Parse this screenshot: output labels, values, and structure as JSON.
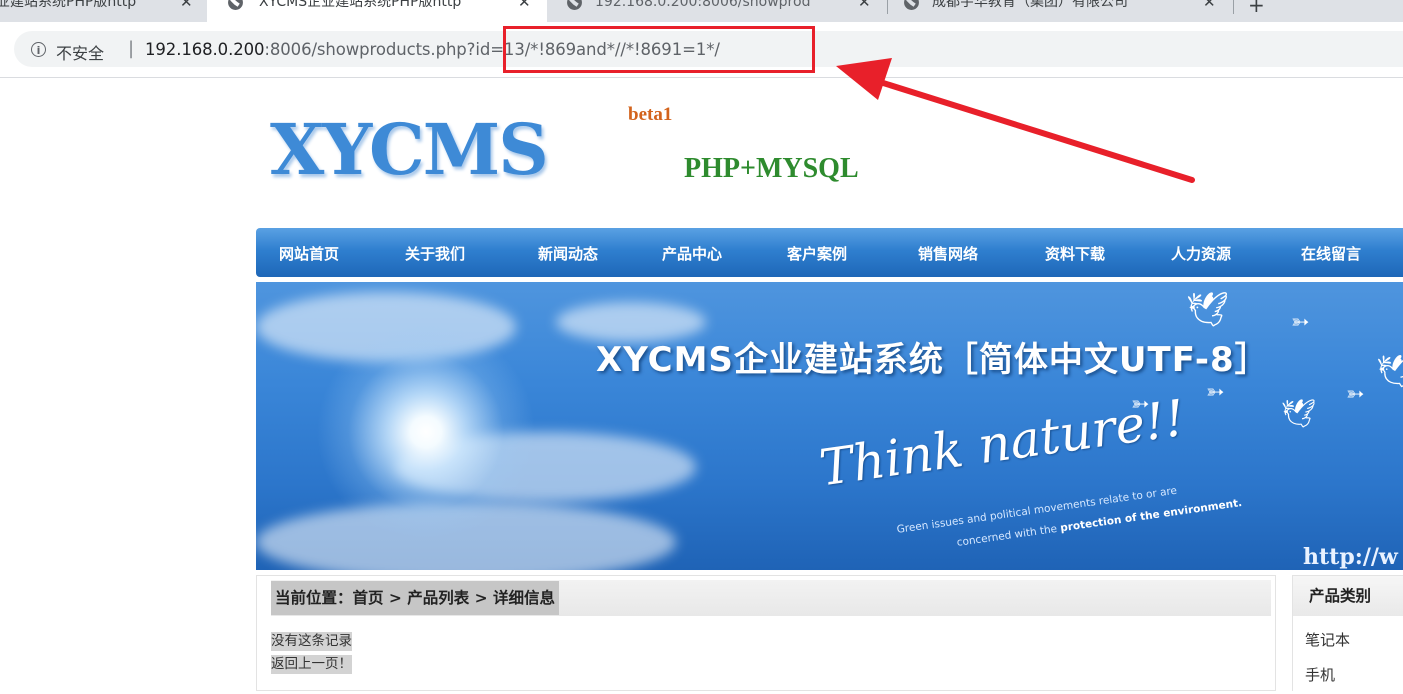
{
  "browser": {
    "tabs": [
      {
        "label": "业建站系统PHP版http"
      },
      {
        "label": "XYCMS企业建站系统PHP版http"
      },
      {
        "label": "192.168.0.200:8006/showprod"
      },
      {
        "label": "成都宇华教育（集团）有限公司"
      }
    ],
    "new_tab_label": "+",
    "close_label": "✕",
    "security_label": "不安全",
    "url_separator": "|",
    "url_host": "192.168.0.200",
    "url_rest": ":8006/showproducts.php?id=13/*!869and*//*!8691=1*/",
    "annotation_color": "#e8202a"
  },
  "site": {
    "logo_text": "XYCMS",
    "beta_label": "beta1",
    "tech_label": "PHP+MYSQL",
    "nav": [
      "网站首页",
      "关于我们",
      "新闻动态",
      "产品中心",
      "客户案例",
      "销售网络",
      "资料下载",
      "人力资源",
      "在线留言"
    ],
    "banner": {
      "title": "XYCMS企业建站系统［简体中文UTF-8］",
      "slogan": "Think nature!!",
      "tagline_line1": "Green issues and political movements relate to or are",
      "tagline_line2_prefix": "concerned with the",
      "tagline_line2_bold": "protection of the environment.",
      "url_text": "http://w"
    },
    "breadcrumb": "当前位置：首页 > 产品列表 > 详细信息",
    "messages": [
      "没有这条记录",
      "返回上一页！"
    ],
    "sidebar": {
      "title": "产品类别",
      "items": [
        "笔记本",
        "手机"
      ]
    }
  }
}
